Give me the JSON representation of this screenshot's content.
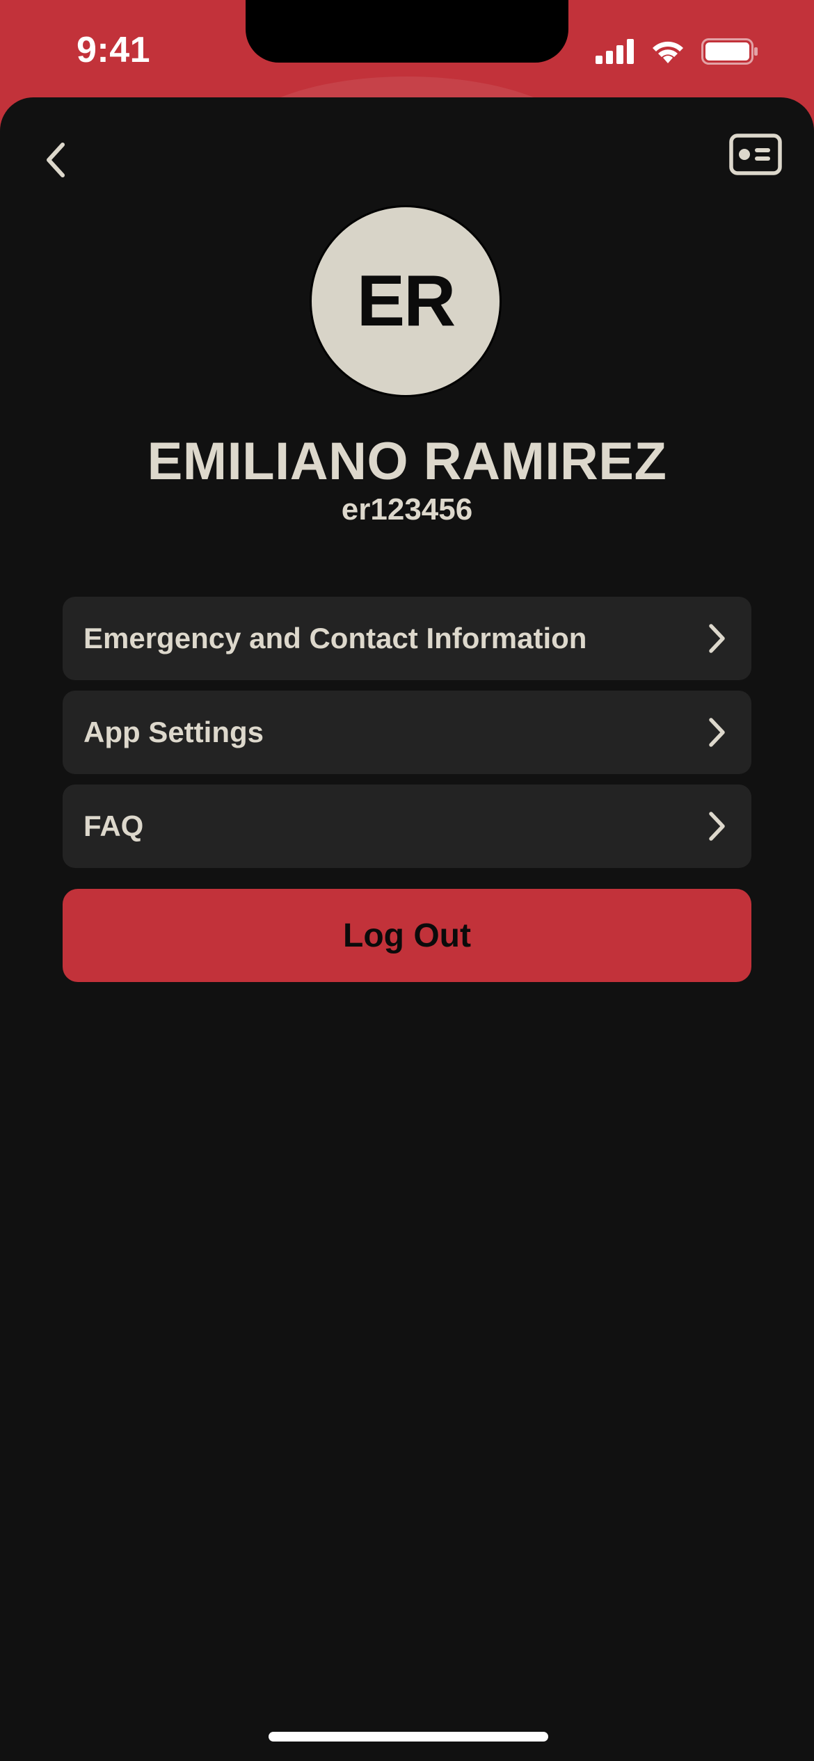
{
  "status_bar": {
    "time": "9:41",
    "icons": [
      "cellular-signal-icon",
      "wifi-icon",
      "battery-icon"
    ]
  },
  "header": {
    "back_icon": "chevron-left-icon",
    "id_card_icon": "id-card-icon"
  },
  "profile": {
    "initials": "ER",
    "name": "EMILIANO RAMIREZ",
    "user_id": "er123456"
  },
  "menu": {
    "items": [
      {
        "label": "Emergency and Contact Information",
        "icon": "chevron-right-icon"
      },
      {
        "label": "App Settings",
        "icon": "chevron-right-icon"
      },
      {
        "label": "FAQ",
        "icon": "chevron-right-icon"
      }
    ]
  },
  "logout": {
    "label": "Log Out"
  },
  "colors": {
    "accent": "#C2323A",
    "background": "#111111",
    "card": "#232323",
    "text": "#DDD8CC",
    "avatar_bg": "#D8D4C8"
  }
}
